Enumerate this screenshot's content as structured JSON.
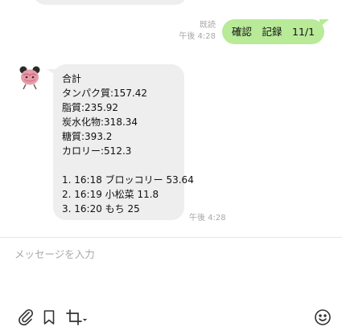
{
  "sent_message": {
    "read_status": "既読",
    "time": "午後 4:28",
    "text": "確認　記録　11/1"
  },
  "received_message": {
    "time": "午後 4:28",
    "lines": [
      "合計",
      "タンパク質:157.42",
      "脂質:235.92",
      "炭水化物:318.34",
      "糖質:393.2",
      "カロリー:512.3",
      "",
      "1. 16:18 ブロッコリー 53.64",
      "2. 16:19 小松菜 11.8",
      "3. 16:20 もち 25"
    ]
  },
  "composer": {
    "placeholder": "メッセージを入力"
  },
  "icons": {
    "attach": "paperclip-icon",
    "keep": "bookmark-icon",
    "screenshot": "crop-icon",
    "emoji": "smiley-icon"
  }
}
